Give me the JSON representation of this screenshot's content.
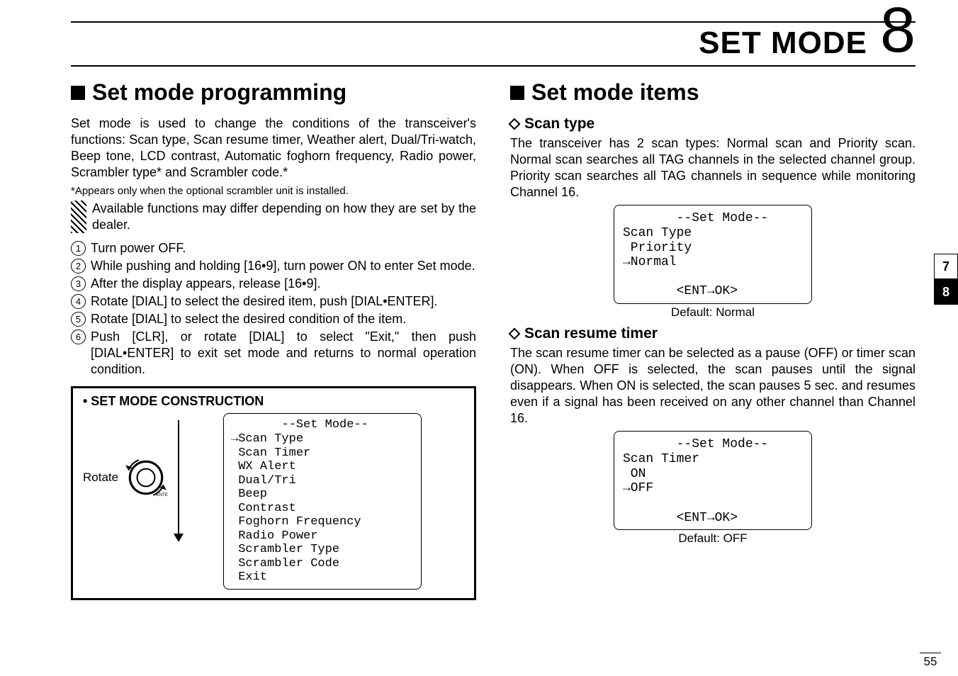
{
  "header": {
    "title": "SET MODE",
    "chapter": "8"
  },
  "left": {
    "heading": "Set mode programming",
    "intro": "Set mode is used to change the conditions of the transceiver's functions: Scan type, Scan resume timer, Weather alert, Dual/Tri-watch, Beep tone, LCD contrast, Automatic foghorn frequency, Radio power, Scrambler type* and Scrambler code.*",
    "note": "*Appears only when the optional scrambler unit is installed.",
    "hatched": "Available functions may differ depending on how they are set by the dealer.",
    "steps": [
      "Turn power OFF.",
      "While pushing and holding [16•9], turn power ON to enter Set mode.",
      "After the display appears, release [16•9].",
      "Rotate [DIAL] to select the desired item, push [DIAL•ENTER].",
      "Rotate [DIAL] to select the desired condition of the item.",
      "Push [CLR], or rotate [DIAL] to select \"Exit,\" then push [DIAL•ENTER] to exit set mode and returns to normal operation condition."
    ],
    "construction": {
      "title": "• SET MODE CONSTRUCTION",
      "rotate_label": "Rotate",
      "lcd_header": "       --Set Mode--",
      "items": [
        "→Scan Type",
        " Scan Timer",
        " WX Alert",
        " Dual/Tri",
        " Beep",
        " Contrast",
        " Foghorn Frequency",
        " Radio Power",
        " Scrambler Type",
        " Scrambler Code",
        " Exit"
      ]
    }
  },
  "right": {
    "heading": "Set mode items",
    "scan_type": {
      "title": "Scan type",
      "text": "The transceiver has 2 scan types: Normal scan and Priority scan. Normal scan searches all TAG channels in the selected channel group. Priority scan searches all TAG channels in sequence while monitoring Channel 16.",
      "lcd_top": "       --Set Mode--\nScan Type\n Priority\n→Normal",
      "lcd_bottom": "       <ENT→OK>",
      "default": "Default: Normal"
    },
    "scan_timer": {
      "title": "Scan resume timer",
      "text": "The scan resume timer can be selected as a pause (OFF) or timer scan (ON). When OFF is selected, the scan pauses until the signal disappears. When ON is selected, the scan pauses 5 sec. and resumes even if a signal has been received on any other channel than Channel 16.",
      "lcd_top": "       --Set Mode--\nScan Timer\n ON\n→OFF",
      "lcd_bottom": "       <ENT→OK>",
      "default": "Default: OFF"
    }
  },
  "tabs": {
    "inactive": "7",
    "active": "8"
  },
  "page": "55"
}
